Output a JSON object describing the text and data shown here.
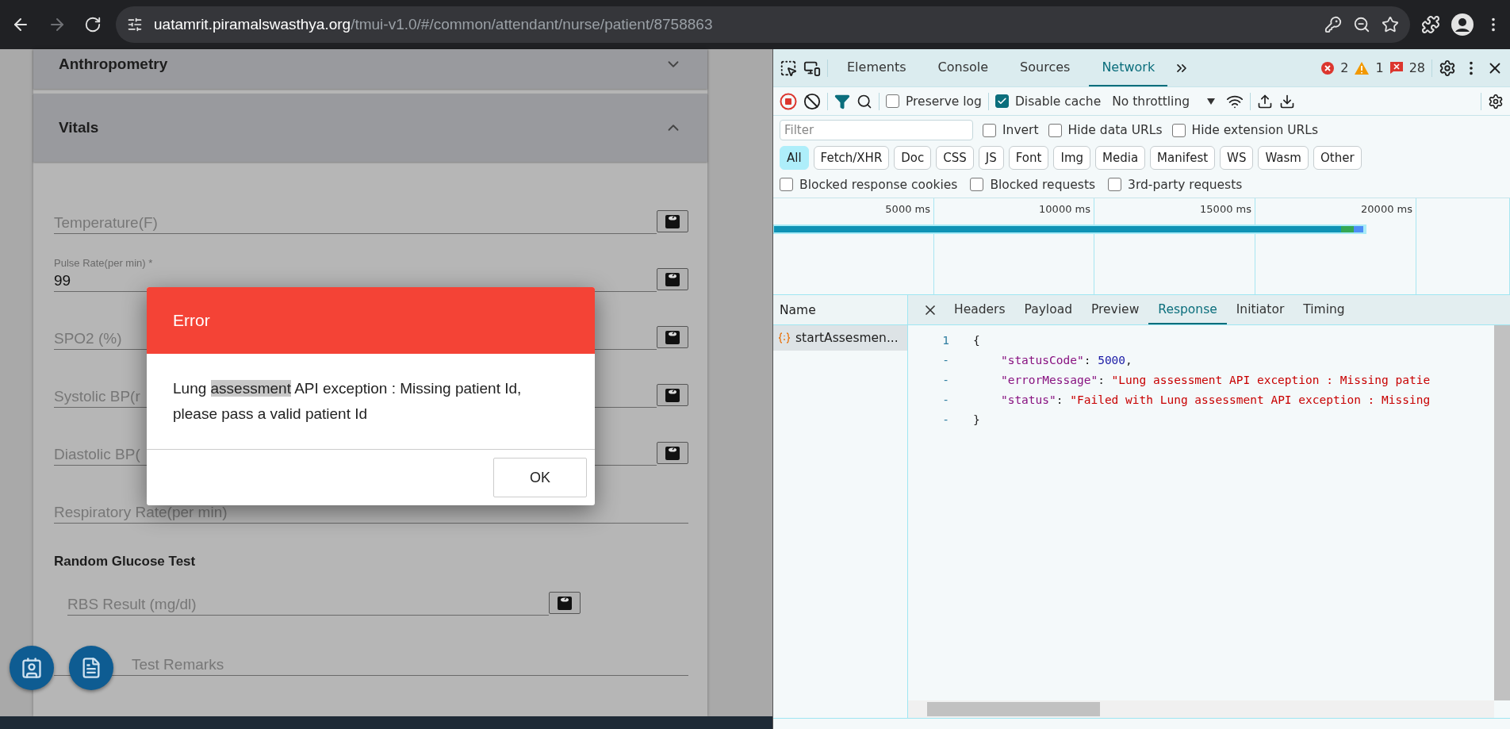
{
  "browser": {
    "url_host": "uatamrit.piramalswasthya.org",
    "url_path": "/tmui-v1.0/#/common/attendant/nurse/patient/8758863",
    "forward_disabled": true
  },
  "page": {
    "sections": [
      {
        "title": "Anthropometry",
        "expanded": false
      },
      {
        "title": "Vitals",
        "expanded": true
      }
    ],
    "fields": [
      {
        "kind": "empty",
        "label": "Temperature(F)",
        "device": true
      },
      {
        "kind": "filled",
        "label": "Pulse Rate(per min) *",
        "value": "99",
        "device": true
      },
      {
        "kind": "empty",
        "label": "SPO2 (%)",
        "device": true
      },
      {
        "kind": "empty",
        "label": "Systolic BP(r",
        "device": true
      },
      {
        "kind": "empty",
        "label": "Diastolic BP(",
        "device": true
      },
      {
        "kind": "empty",
        "label": "Respiratory Rate(per min)",
        "device": false
      }
    ],
    "glucose": {
      "title": "Random Glucose Test",
      "result_label": "RBS Result (mg/dl)",
      "remarks_label": "Test Remarks"
    }
  },
  "dialog": {
    "title": "Error",
    "message": {
      "before": "Lung ",
      "highlight": "assessment",
      "after": " API exception : Missing patient Id, please pass a valid patient Id"
    },
    "ok": "OK"
  },
  "devtools": {
    "tabs": [
      {
        "label": "Elements",
        "selected": false
      },
      {
        "label": "Console",
        "selected": false
      },
      {
        "label": "Sources",
        "selected": false
      },
      {
        "label": "Network",
        "selected": true
      }
    ],
    "errors": "2",
    "warnings": "1",
    "issues": "28",
    "preserve_log": {
      "label": "Preserve log",
      "checked": false
    },
    "disable_cache": {
      "label": "Disable cache",
      "checked": true
    },
    "throttling": "No throttling",
    "filter": {
      "placeholder": "Filter"
    },
    "filter_options": [
      {
        "label": "Invert",
        "checked": false
      },
      {
        "label": "Hide data URLs",
        "checked": false
      },
      {
        "label": "Hide extension URLs",
        "checked": false
      }
    ],
    "types": [
      {
        "label": "All",
        "selected": true
      },
      {
        "label": "Fetch/XHR",
        "selected": false
      },
      {
        "label": "Doc",
        "selected": false
      },
      {
        "label": "CSS",
        "selected": false
      },
      {
        "label": "JS",
        "selected": false
      },
      {
        "label": "Font",
        "selected": false
      },
      {
        "label": "Img",
        "selected": false
      },
      {
        "label": "Media",
        "selected": false
      },
      {
        "label": "Manifest",
        "selected": false
      },
      {
        "label": "WS",
        "selected": false
      },
      {
        "label": "Wasm",
        "selected": false
      },
      {
        "label": "Other",
        "selected": false
      }
    ],
    "block_options": [
      {
        "label": "Blocked response cookies",
        "checked": false
      },
      {
        "label": "Blocked requests",
        "checked": false
      },
      {
        "label": "3rd-party requests",
        "checked": false
      }
    ],
    "timeline_ticks": [
      "5000 ms",
      "10000 ms",
      "15000 ms",
      "20000 ms"
    ],
    "name_header": "Name",
    "requests": [
      {
        "name": "startAssesmen...",
        "selected": true
      }
    ],
    "detail_tabs": [
      {
        "label": "Headers",
        "selected": false
      },
      {
        "label": "Payload",
        "selected": false
      },
      {
        "label": "Preview",
        "selected": false
      },
      {
        "label": "Response",
        "selected": true
      },
      {
        "label": "Initiator",
        "selected": false
      },
      {
        "label": "Timing",
        "selected": false
      }
    ],
    "code": [
      {
        "gutter": "1",
        "text": "{"
      },
      {
        "gutter": "-",
        "key": "\"statusCode\"",
        "colon": ":",
        "value": "5000",
        "kind": "number",
        "trail": ","
      },
      {
        "gutter": "-",
        "key": "\"errorMessage\"",
        "colon": ":",
        "value": "\"Lung assessment API exception : Missing patie",
        "kind": "string"
      },
      {
        "gutter": "-",
        "key": "\"status\"",
        "colon": ":",
        "value": "\"Failed with Lung assessment API exception : Missing",
        "kind": "string"
      },
      {
        "gutter": "-",
        "text": "}"
      }
    ]
  }
}
